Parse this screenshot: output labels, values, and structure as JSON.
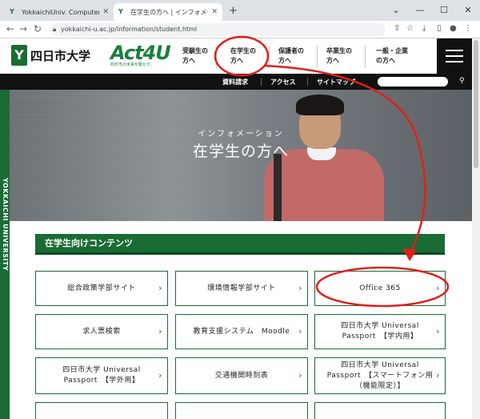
{
  "browser": {
    "tabs": [
      {
        "label": "YokkaichiUniv. ComputerCenter",
        "active": false
      },
      {
        "label": "在学生の方へ | インフォメーション | 四日市大学",
        "active": true
      }
    ],
    "new_tab": "+",
    "url": "yokkaichi-u.ac.jp/information/student.html"
  },
  "site": {
    "logo_text": "四日市大学",
    "logo_mark": "Y",
    "act_logo": "Act4U",
    "act_tagline": "四日市の未来を動かす。",
    "gnav": [
      {
        "line1": "受験生の",
        "line2": "方へ"
      },
      {
        "line1": "在学生の",
        "line2": "方へ"
      },
      {
        "line1": "保護者の",
        "line2": "方へ"
      },
      {
        "line1": "卒業生の",
        "line2": "方へ"
      },
      {
        "line1": "一般・企業",
        "line2": "の方へ"
      }
    ],
    "sublinks": [
      "資料請求",
      "アクセス",
      "サイトマップ"
    ],
    "side_text": "YOKKAICHI UNIVERSITY"
  },
  "hero": {
    "subtitle": "インフォメーション",
    "title": "在学生の方へ"
  },
  "section": {
    "title": "在学生向けコンテンツ",
    "cards": [
      {
        "label": "総合政策学部サイト"
      },
      {
        "label": "環境情報学部サイト"
      },
      {
        "label": "Office 365"
      },
      {
        "label": "求人票検索"
      },
      {
        "label": "教育支援システム　Moodle"
      },
      {
        "label": "四日市大学 Universal Passport　【学内用】"
      },
      {
        "label": "四日市大学 Universal Passport　【学外用】"
      },
      {
        "label": "交通機関時刻表"
      },
      {
        "label": "四日市大学 Universal Passport　【スマートフォン用（機能限定）】"
      }
    ],
    "arrow": "›"
  },
  "annotation": {
    "color": "#e0201a"
  },
  "colors": {
    "brand_green": "#1a6b34"
  }
}
